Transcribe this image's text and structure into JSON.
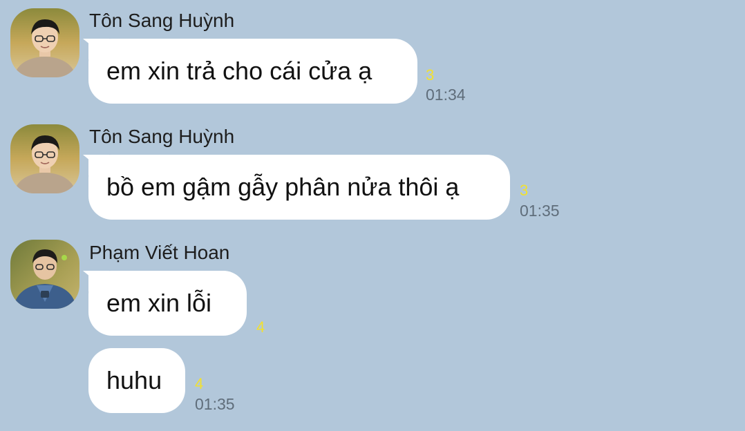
{
  "messages": [
    {
      "sender": "Tôn Sang Huỳnh",
      "text": "em xin trả cho cái cửa ạ",
      "unread": "3",
      "time": "01:34"
    },
    {
      "sender": "Tôn Sang Huỳnh",
      "text": "bồ em gậm gẫy phân nửa thôi ạ",
      "unread": "3",
      "time": "01:35"
    },
    {
      "sender": "Phạm Viết Hoan",
      "text": "em xin lỗi",
      "unread": "4"
    },
    {
      "text": "huhu",
      "unread": "4",
      "time": "01:35"
    }
  ],
  "colors": {
    "background": "#b2c7da",
    "bubble": "#ffffff",
    "unread": "#f2e12f",
    "time": "#5f6d7a"
  },
  "icons": [
    "avatar-ton-sang-huynh",
    "avatar-pham-viet-hoan"
  ]
}
